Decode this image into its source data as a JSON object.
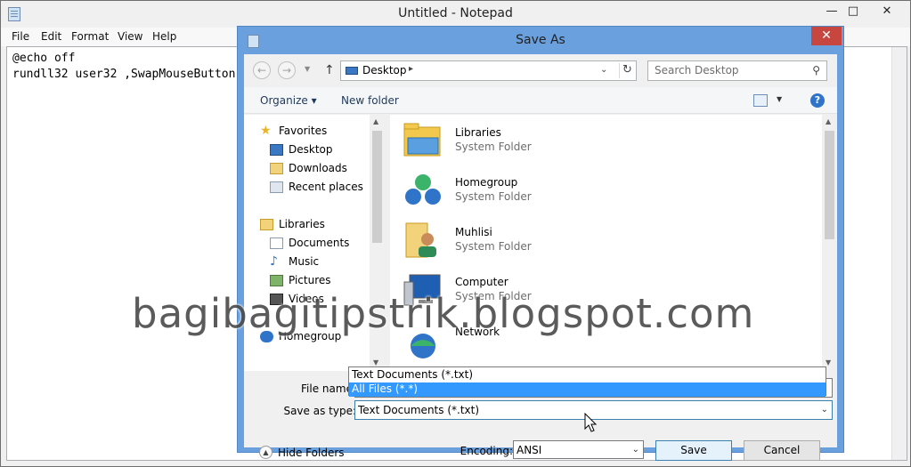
{
  "notepad": {
    "title": "Untitled - Notepad",
    "menu": [
      "File",
      "Edit",
      "Format",
      "View",
      "Help"
    ],
    "content_lines": [
      "@echo off",
      "rundll32 user32 ,SwapMouseButton"
    ],
    "controls": {
      "minimize": "—",
      "maximize": "□",
      "close": "✕"
    }
  },
  "dialog": {
    "title": "Save As",
    "close_label": "✕",
    "address": {
      "location": "Desktop"
    },
    "search": {
      "placeholder": "Search Desktop"
    },
    "toolbar": {
      "organize": "Organize ▾",
      "new_folder": "New folder",
      "help": "?"
    },
    "nav_pane": {
      "favorites": {
        "label": "Favorites",
        "items": [
          "Desktop",
          "Downloads",
          "Recent places"
        ]
      },
      "libraries": {
        "label": "Libraries",
        "items": [
          "Documents",
          "Music",
          "Pictures",
          "Videos"
        ]
      },
      "homegroup": "Homegroup"
    },
    "files": [
      {
        "name": "Libraries",
        "type": "System Folder",
        "icon": "libraries-folder-icon"
      },
      {
        "name": "Homegroup",
        "type": "System Folder",
        "icon": "homegroup-icon"
      },
      {
        "name": "Muhlisi",
        "type": "System Folder",
        "icon": "user-folder-icon"
      },
      {
        "name": "Computer",
        "type": "System Folder",
        "icon": "computer-icon"
      },
      {
        "name": "Network",
        "type": "",
        "icon": "network-icon"
      }
    ],
    "file_name": {
      "label": "File name:",
      "value": ""
    },
    "save_as_type": {
      "label": "Save as type:",
      "value": "Text Documents (*.txt)",
      "options": [
        "Text Documents (*.txt)",
        "All Files  (*.*)"
      ],
      "highlighted": "All Files  (*.*)"
    },
    "encoding": {
      "label": "Encoding:",
      "value": "ANSI"
    },
    "hide_folders": "Hide Folders",
    "save_button": "Save",
    "cancel_button": "Cancel"
  },
  "watermark": "bagibagitipstrik.blogspot.com"
}
